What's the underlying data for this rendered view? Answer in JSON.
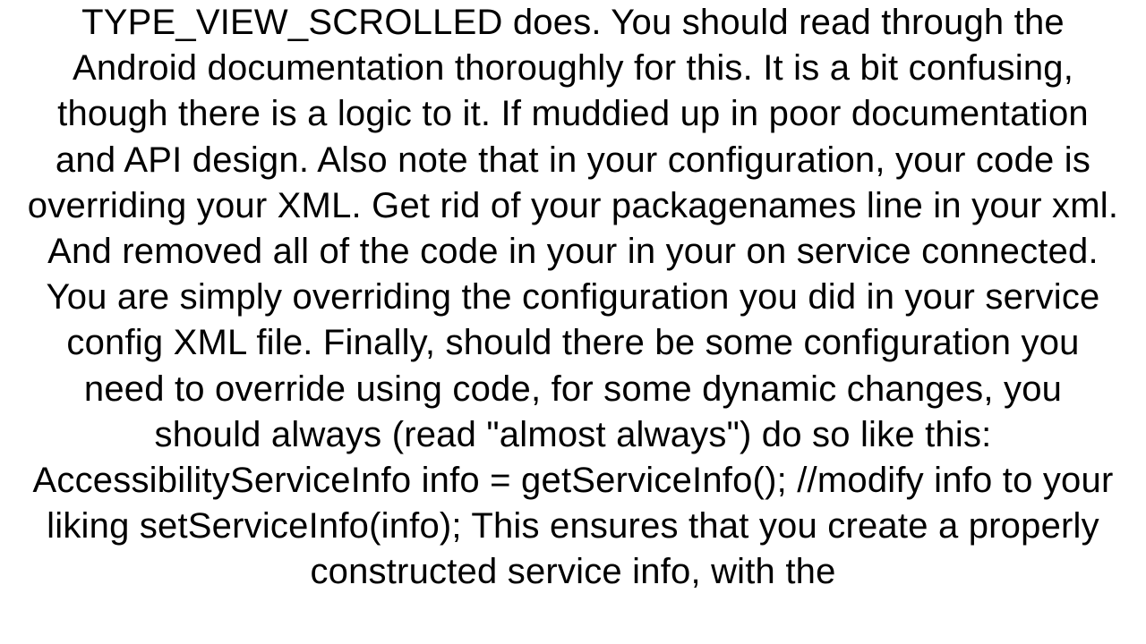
{
  "document": {
    "body_text": "TYPE_VIEW_SCROLLED does.  You should read through the Android documentation thoroughly for this.  It is a bit confusing, though there is a logic to it.  If muddied up in poor documentation and API design.  Also note that in your configuration, your code is overriding your XML.  Get rid of your packagenames line in your xml.  And removed all of the code in your in your on service connected.  You are simply overriding the configuration you did in your service config XML file. Finally, should there be some configuration you need to override using code, for some dynamic changes, you should always (read \"almost always\") do so like this: AccessibilityServiceInfo info = getServiceInfo(); //modify info to your liking setServiceInfo(info);  This ensures that you create a properly constructed service info, with the"
  }
}
